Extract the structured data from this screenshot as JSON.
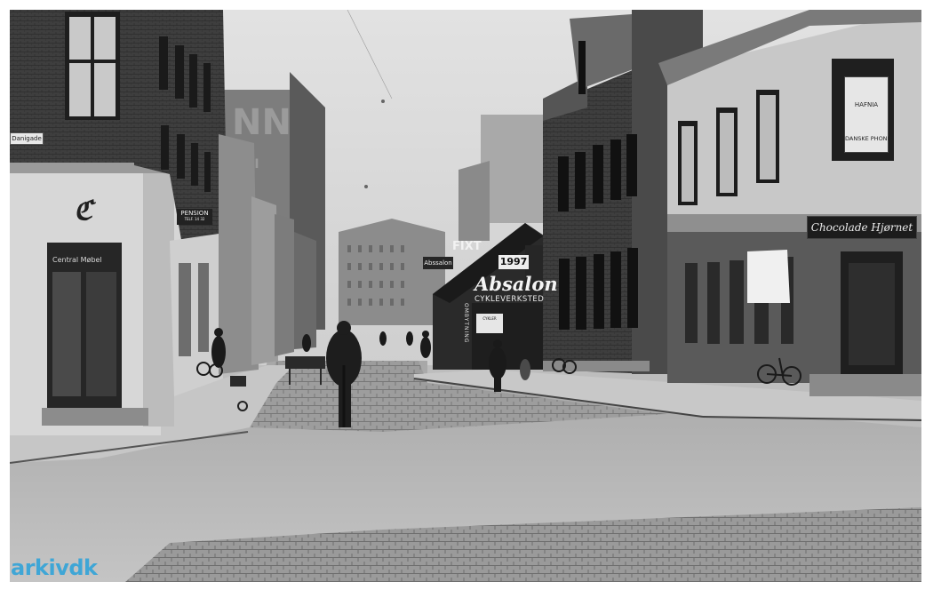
{
  "photo": {
    "description_type": "black-and-white archival street photograph",
    "colors": {
      "sky": "#d6d6d6",
      "road": "#b4b4b4",
      "cobbles": "#8e8e8e",
      "watermark": "#3fa6d6"
    }
  },
  "signs": {
    "street_sign": "Danigade",
    "pension_title": "PENSION",
    "pension_sub": "TELF. 14 32",
    "shop_left": "Central Møbel",
    "logo": "ℭ",
    "plakat": "Abssalon",
    "fixt": "FIXT",
    "year": "1997",
    "absalon": "Absalon",
    "cykleverksted": "CYKLEVERKSTED",
    "vertical": "OMBYTNING",
    "bell": "CYKLER",
    "hafnia_top": "HAFNIA",
    "hafnia_bottom": "DANSKE PHONIX",
    "chocolade": "Chocolade Hjørnet"
  },
  "watermark": {
    "brand": "arkiv",
    "suffix": "dk"
  }
}
